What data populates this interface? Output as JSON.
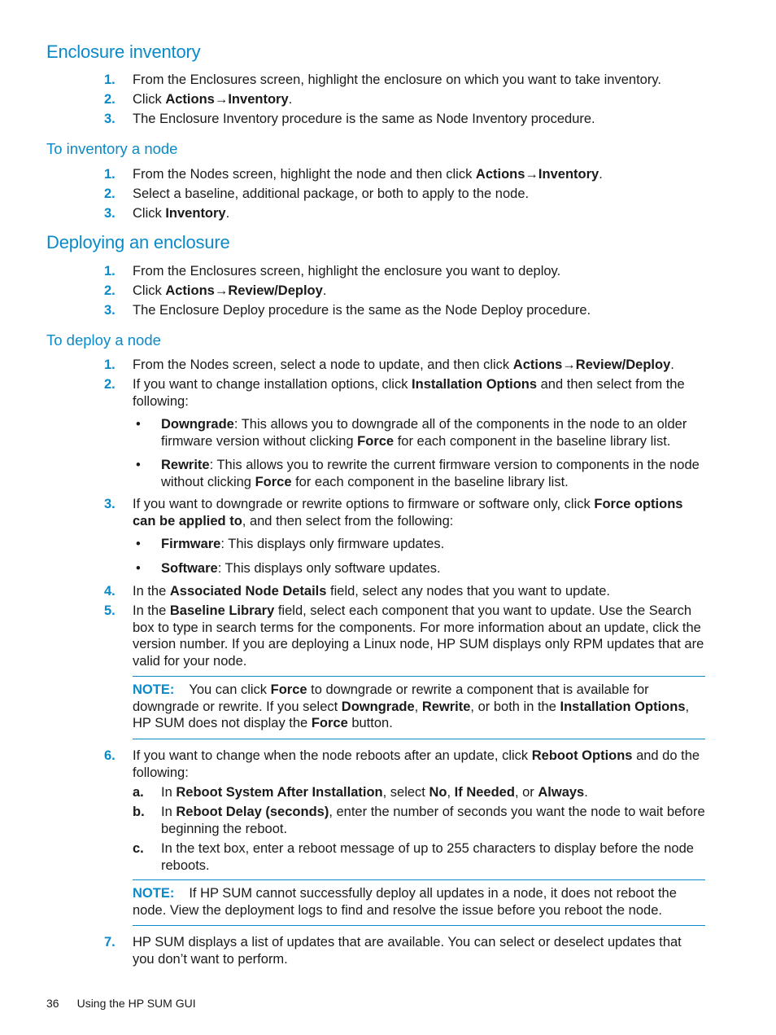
{
  "colors": {
    "accent": "#0a8ac8",
    "text": "#1a1a1a"
  },
  "sections": {
    "enclosure_inventory": {
      "title": "Enclosure inventory",
      "steps": [
        {
          "num": "1.",
          "segs": [
            {
              "t": "From the Enclosures screen, highlight the enclosure on which you want to take inventory."
            }
          ]
        },
        {
          "num": "2.",
          "segs": [
            {
              "t": "Click "
            },
            {
              "t": "Actions→Inventory",
              "b": true
            },
            {
              "t": "."
            }
          ]
        },
        {
          "num": "3.",
          "segs": [
            {
              "t": "The Enclosure Inventory procedure is the same as Node Inventory procedure."
            }
          ]
        }
      ]
    },
    "inventory_node": {
      "title": "To inventory a node",
      "steps": [
        {
          "num": "1.",
          "segs": [
            {
              "t": "From the Nodes screen, highlight the node and then click "
            },
            {
              "t": "Actions→Inventory",
              "b": true
            },
            {
              "t": "."
            }
          ]
        },
        {
          "num": "2.",
          "segs": [
            {
              "t": "Select a baseline, additional package, or both to apply to the node."
            }
          ]
        },
        {
          "num": "3.",
          "segs": [
            {
              "t": "Click "
            },
            {
              "t": "Inventory",
              "b": true
            },
            {
              "t": "."
            }
          ]
        }
      ]
    },
    "deploying_enclosure": {
      "title": "Deploying an enclosure",
      "steps": [
        {
          "num": "1.",
          "segs": [
            {
              "t": "From the Enclosures screen, highlight the enclosure you want to deploy."
            }
          ]
        },
        {
          "num": "2.",
          "segs": [
            {
              "t": "Click "
            },
            {
              "t": "Actions→Review/Deploy",
              "b": true
            },
            {
              "t": "."
            }
          ]
        },
        {
          "num": "3.",
          "segs": [
            {
              "t": "The Enclosure Deploy procedure is the same as the Node Deploy procedure."
            }
          ]
        }
      ]
    },
    "deploy_node": {
      "title": "To deploy a node",
      "steps": [
        {
          "num": "1.",
          "segs": [
            {
              "t": "From the Nodes screen, select a node to update, and then click "
            },
            {
              "t": "Actions→Review/Deploy",
              "b": true
            },
            {
              "t": "."
            }
          ]
        },
        {
          "num": "2.",
          "segs": [
            {
              "t": "If you want to change installation options, click "
            },
            {
              "t": "Installation Options",
              "b": true
            },
            {
              "t": " and then select from the following:"
            }
          ]
        },
        {
          "num": "3.",
          "segs": [
            {
              "t": "If you want to downgrade or rewrite options to firmware or software only, click "
            },
            {
              "t": "Force options can be applied to",
              "b": true
            },
            {
              "t": ", and then select from the following:"
            }
          ]
        },
        {
          "num": "4.",
          "segs": [
            {
              "t": "In the "
            },
            {
              "t": "Associated Node Details",
              "b": true
            },
            {
              "t": " field, select any nodes that you want to update."
            }
          ]
        },
        {
          "num": "5.",
          "segs": [
            {
              "t": "In the "
            },
            {
              "t": "Baseline Library",
              "b": true
            },
            {
              "t": " field, select each component that you want to update. Use the Search box to type in search terms for the components. For more information about an update, click the version number. If you are deploying a Linux node, HP SUM displays only RPM updates that are valid for your node."
            }
          ]
        },
        {
          "num": "6.",
          "segs": [
            {
              "t": "If you want to change when the node reboots after an update, click "
            },
            {
              "t": "Reboot Options",
              "b": true
            },
            {
              "t": " and do the following:"
            }
          ]
        },
        {
          "num": "7.",
          "segs": [
            {
              "t": "HP SUM displays a list of updates that are available. You can select or deselect updates that you don’t want to perform."
            }
          ]
        }
      ],
      "bullets_step2": [
        {
          "segs": [
            {
              "t": "Downgrade",
              "b": true
            },
            {
              "t": ": This allows you to downgrade all of the components in the node to an older firmware version without clicking "
            },
            {
              "t": "Force",
              "b": true
            },
            {
              "t": " for each component in the baseline library list."
            }
          ]
        },
        {
          "segs": [
            {
              "t": "Rewrite",
              "b": true
            },
            {
              "t": ": This allows you to rewrite the current firmware version to components in the node without clicking "
            },
            {
              "t": "Force",
              "b": true
            },
            {
              "t": " for each component in the baseline library list."
            }
          ]
        }
      ],
      "bullets_step3": [
        {
          "segs": [
            {
              "t": "Firmware",
              "b": true
            },
            {
              "t": ": This displays only firmware updates."
            }
          ]
        },
        {
          "segs": [
            {
              "t": "Software",
              "b": true
            },
            {
              "t": ": This displays only software updates."
            }
          ]
        }
      ],
      "bullet_glyph": "•",
      "note1": {
        "label": "NOTE:",
        "segs": [
          {
            "t": "You can click "
          },
          {
            "t": "Force",
            "b": true
          },
          {
            "t": " to downgrade or rewrite a component that is available for downgrade or rewrite. If you select "
          },
          {
            "t": "Downgrade",
            "b": true
          },
          {
            "t": ", "
          },
          {
            "t": "Rewrite",
            "b": true
          },
          {
            "t": ", or both in the "
          },
          {
            "t": "Installation Options",
            "b": true
          },
          {
            "t": ", HP SUM does not display the "
          },
          {
            "t": "Force",
            "b": true
          },
          {
            "t": " button."
          }
        ]
      },
      "substeps_step6": [
        {
          "label": "a.",
          "segs": [
            {
              "t": "In "
            },
            {
              "t": "Reboot System After Installation",
              "b": true
            },
            {
              "t": ", select "
            },
            {
              "t": "No",
              "b": true
            },
            {
              "t": ", "
            },
            {
              "t": "If Needed",
              "b": true
            },
            {
              "t": ", or "
            },
            {
              "t": "Always",
              "b": true
            },
            {
              "t": "."
            }
          ]
        },
        {
          "label": "b.",
          "segs": [
            {
              "t": "In "
            },
            {
              "t": "Reboot Delay (seconds)",
              "b": true
            },
            {
              "t": ", enter the number of seconds you want the node to wait before beginning the reboot."
            }
          ]
        },
        {
          "label": "c.",
          "segs": [
            {
              "t": "In the text box, enter a reboot message of up to 255 characters to display before the node reboots."
            }
          ]
        }
      ],
      "note2": {
        "label": "NOTE:",
        "segs": [
          {
            "t": "If HP SUM cannot successfully deploy all updates in a node, it does not reboot the node. View the deployment logs to find and resolve the issue before you reboot the node."
          }
        ]
      }
    }
  },
  "footer": {
    "page_number": "36",
    "chapter": "Using the HP SUM GUI"
  }
}
